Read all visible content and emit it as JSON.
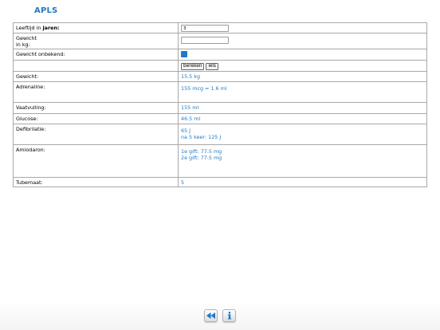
{
  "app": {
    "title": "APLS"
  },
  "form": {
    "age_label_prefix": "Leeftijd in ",
    "age_label_bold": "jaren:",
    "age_value": "3",
    "weight_label_line1": "Gewicht",
    "weight_label_line2": "in kg:",
    "weight_value": "",
    "weight_unknown_label": "Gewicht onbekend:",
    "weight_unknown_checked": true,
    "calculate_button": "bereken",
    "clear_button": "wis"
  },
  "results": {
    "weight_label": "Gewicht:",
    "weight_value": "15.5 kg",
    "adrenaline_label": "Adrenaline:",
    "adrenaline_value": "155 mcg = 1.6 ml",
    "fluid_label": "Vaatvulling:",
    "fluid_value": "155 ml",
    "glucose_label": "Glucose:",
    "glucose_value": "46.5 ml",
    "defib_label": "Defibrilatie:",
    "defib_value_1": "65 J",
    "defib_value_2": "na 5 keer: 125 J",
    "amiodarone_label": "Amiodaron:",
    "amiodarone_value_1": "1e gift: 77.5 mg",
    "amiodarone_value_2": "2e gift: 77.5 mg",
    "tube_label": "Tubemaat:",
    "tube_value": "5"
  },
  "toolbar": {
    "back_icon": "rewind-icon",
    "info_icon": "info-icon"
  },
  "colors": {
    "accent": "#1f78c8",
    "border": "#a8a8a8"
  }
}
